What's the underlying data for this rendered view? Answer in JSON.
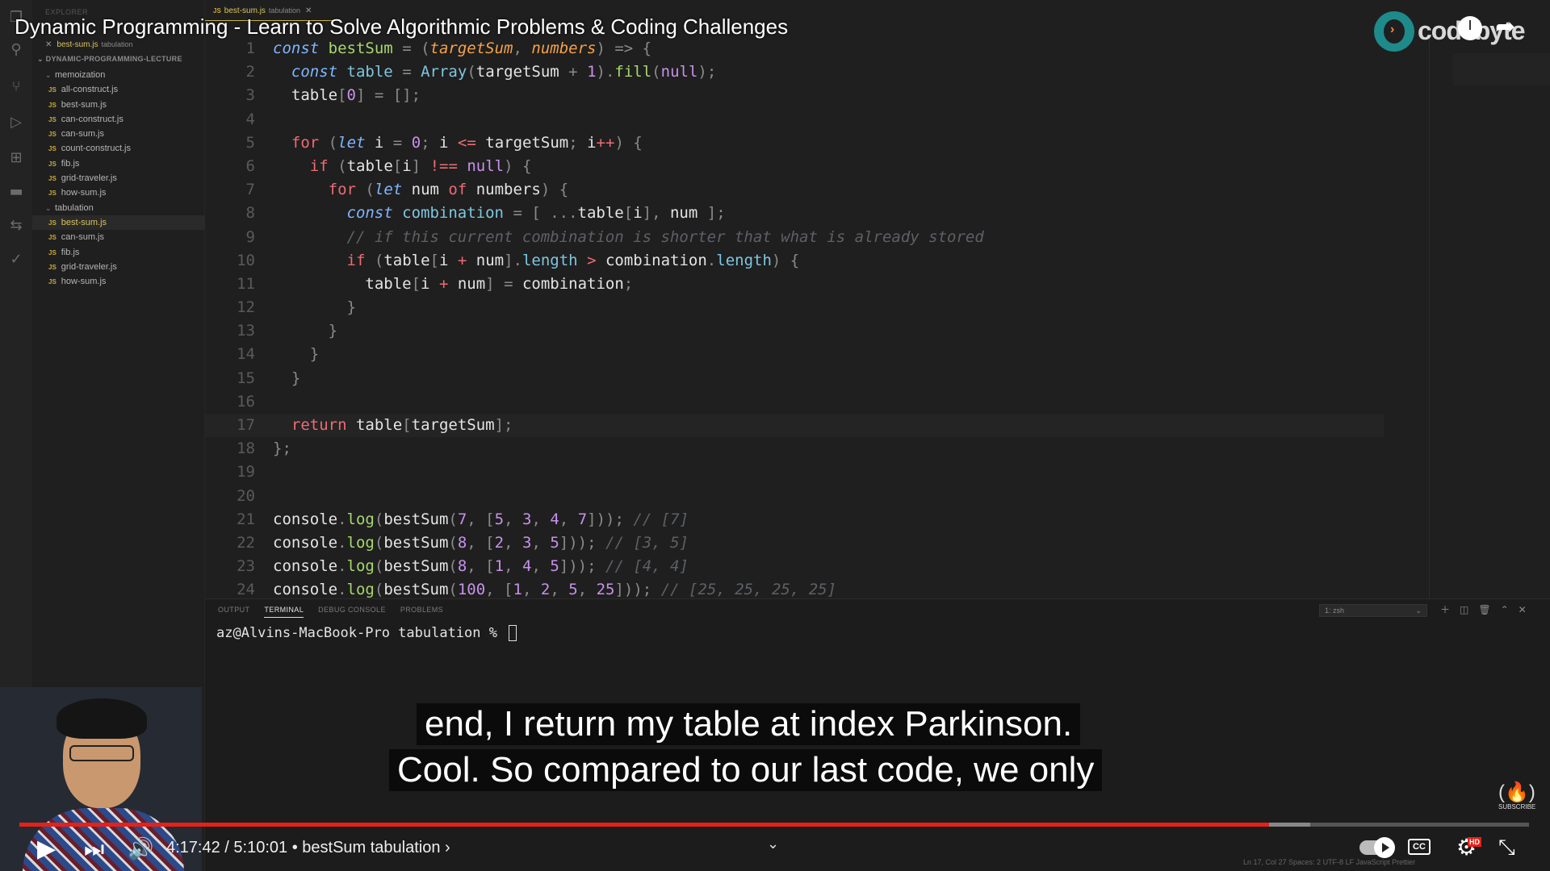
{
  "video": {
    "title": "Dynamic Programming - Learn to Solve Algorithmic Problems & Coding Challenges",
    "brand": "codebyte",
    "time_current": "4:17:42",
    "time_sep": " / ",
    "time_total": "5:10:01",
    "chapter": "• bestSum tabulation ›",
    "progress_fraction": 0.828,
    "buffered_fraction": 0.855,
    "subscribe_label": "SUBSCRIBE",
    "hd_badge": "HD",
    "cc_label": "CC"
  },
  "captions": {
    "line1": "end, I return my table at index Parkinson.",
    "line2": "Cool. So compared to our last code, we only"
  },
  "editor": {
    "sidebar_header": "EXPLORER",
    "open_file": "best-sum.js",
    "open_file_dir": "tabulation",
    "project": "DYNAMIC-PROGRAMMING-LECTURE",
    "tab_file": "best-sum.js",
    "tab_dir": "tabulation",
    "tree": [
      {
        "type": "folder",
        "name": "memoization"
      },
      {
        "type": "file",
        "name": "all-construct.js"
      },
      {
        "type": "file",
        "name": "best-sum.js"
      },
      {
        "type": "file",
        "name": "can-construct.js"
      },
      {
        "type": "file",
        "name": "can-sum.js"
      },
      {
        "type": "file",
        "name": "count-construct.js"
      },
      {
        "type": "file",
        "name": "fib.js"
      },
      {
        "type": "file",
        "name": "grid-traveler.js"
      },
      {
        "type": "file",
        "name": "how-sum.js"
      },
      {
        "type": "folder",
        "name": "tabulation"
      },
      {
        "type": "file",
        "name": "best-sum.js",
        "active": true
      },
      {
        "type": "file",
        "name": "can-sum.js"
      },
      {
        "type": "file",
        "name": "fib.js"
      },
      {
        "type": "file",
        "name": "grid-traveler.js"
      },
      {
        "type": "file",
        "name": "how-sum.js"
      }
    ],
    "lines": [
      "1",
      "2",
      "3",
      "4",
      "5",
      "6",
      "7",
      "8",
      "9",
      "10",
      "11",
      "12",
      "13",
      "14",
      "15",
      "16",
      "17",
      "18",
      "19",
      "20",
      "21",
      "22",
      "23",
      "24"
    ]
  },
  "panel": {
    "tabs": [
      "OUTPUT",
      "TERMINAL",
      "DEBUG CONSOLE",
      "PROBLEMS"
    ],
    "active_tab": "TERMINAL",
    "shell": "1: zsh",
    "prompt": "az@Alvins-MacBook-Pro tabulation % "
  },
  "status": {
    "text": "Ln 17, Col 27   Spaces: 2   UTF-8   LF   JavaScript   Prettier"
  },
  "icons": [
    "files-icon",
    "search-icon",
    "source-control-icon",
    "run-icon",
    "extensions-icon",
    "docker-icon",
    "remote-icon",
    "account-icon",
    "settings-icon",
    "play-icon",
    "next-icon",
    "volume-icon",
    "autoplay-toggle",
    "captions-icon",
    "settings-gear-icon",
    "fullscreen-exit-icon",
    "clock-icon",
    "share-icon"
  ]
}
